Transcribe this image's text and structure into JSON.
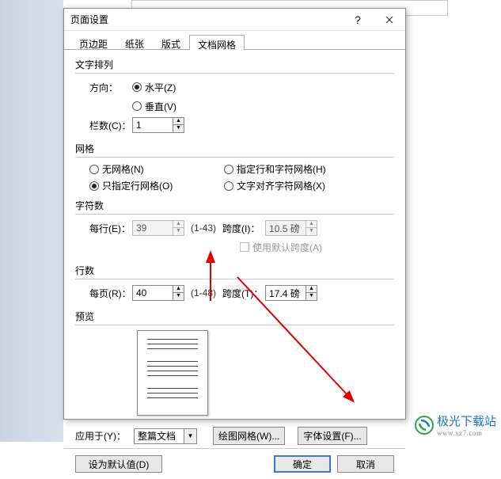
{
  "dialog": {
    "title": "页面设置"
  },
  "tabs": {
    "margins": "页边距",
    "paper": "纸张",
    "layout": "版式",
    "grid": "文档网格"
  },
  "text_direction": {
    "group": "文字排列",
    "direction_label": "方向：",
    "horizontal": "水平(Z)",
    "vertical": "垂直(V)",
    "columns_label": "栏数(C)：",
    "columns_value": "1"
  },
  "grid": {
    "group": "网格",
    "none": "无网格(N)",
    "lines_only": "只指定行网格(O)",
    "lines_chars": "指定行和字符网格(H)",
    "snap_chars": "文字对齐字符网格(X)"
  },
  "chars": {
    "group": "字符数",
    "per_line_label": "每行(E)：",
    "per_line_value": "39",
    "per_line_range": "(1-43)",
    "pitch_label": "跨度(I)：",
    "pitch_value": "10.5 磅",
    "use_default": "使用默认跨度(A)"
  },
  "lines": {
    "group": "行数",
    "per_page_label": "每页(R)：",
    "per_page_value": "40",
    "per_page_range": "(1-48)",
    "pitch_label": "跨度(T)：",
    "pitch_value": "17.4 磅"
  },
  "preview": {
    "group": "预览"
  },
  "footer": {
    "apply_to_label": "应用于(Y)：",
    "apply_to_value": "整篇文档",
    "drawing_grid": "绘图网格(W)...",
    "font_settings": "字体设置(F)..."
  },
  "buttons": {
    "set_default": "设为默认值(D)",
    "ok": "确定",
    "cancel": "取消"
  },
  "watermark": {
    "text": "极光下载站",
    "url": "www.xz7.com"
  }
}
